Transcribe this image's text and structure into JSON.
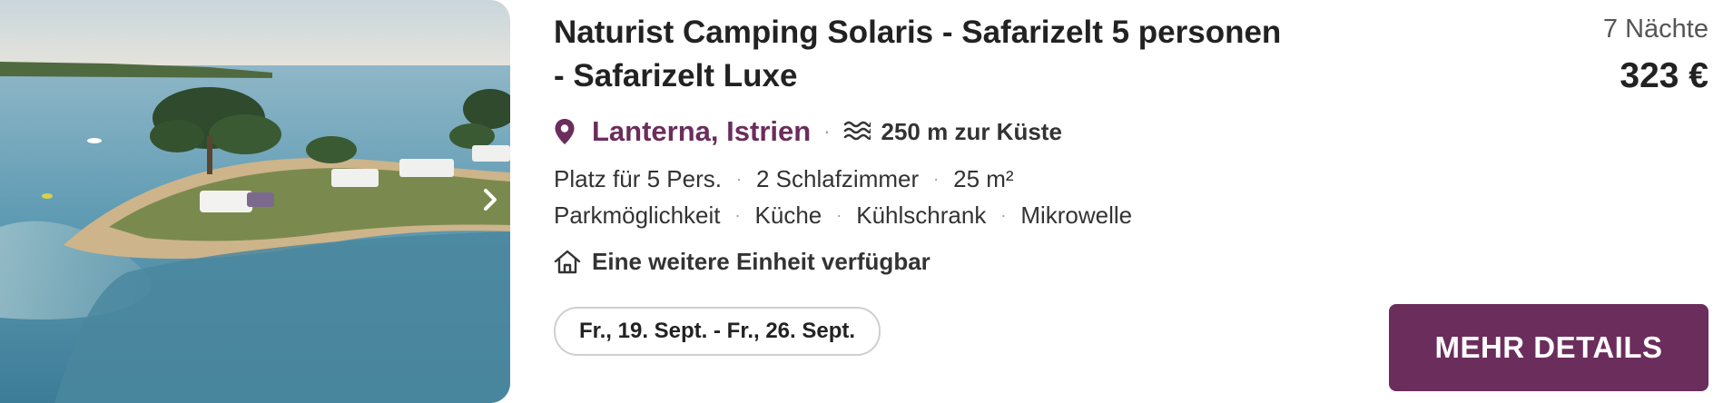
{
  "listing": {
    "title": "Naturist Camping Solaris - Safarizelt 5 personen - Safarizelt Luxe",
    "location": "Lanterna, Istrien",
    "coast_distance": "250 m zur Küste",
    "separator": "·",
    "capacity": "Platz für 5 Pers.",
    "bedrooms": "2 Schlafzimmer",
    "area": "25 m²",
    "amenities": [
      "Parkmöglichkeit",
      "Küche",
      "Kühlschrank",
      "Mikrowelle"
    ],
    "availability": "Eine weitere Einheit verfügbar",
    "date_range": "Fr., 19. Sept. - Fr., 26. Sept."
  },
  "pricing": {
    "nights": "7 Nächte",
    "price": "323 €"
  },
  "actions": {
    "details_label": "MEHR DETAILS"
  },
  "icons": {
    "location": "map-pin-icon",
    "coast": "waves-icon",
    "unit": "house-icon",
    "photo_next": "chevron-right-icon"
  },
  "colors": {
    "accent": "#6b2d5c",
    "text": "#222222",
    "muted": "#555555",
    "chip_border": "#cfcfcf"
  }
}
